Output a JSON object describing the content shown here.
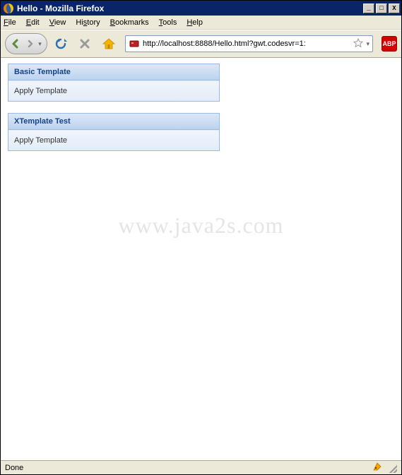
{
  "window": {
    "title": "Hello - Mozilla Firefox"
  },
  "menu": {
    "items": [
      {
        "label": "File",
        "accel": "F"
      },
      {
        "label": "Edit",
        "accel": "E"
      },
      {
        "label": "View",
        "accel": "V"
      },
      {
        "label": "History",
        "accel": "H"
      },
      {
        "label": "Bookmarks",
        "accel": "B"
      },
      {
        "label": "Tools",
        "accel": "T"
      },
      {
        "label": "Help",
        "accel": "H"
      }
    ]
  },
  "toolbar": {
    "url": "http://localhost:8888/Hello.html?gwt.codesvr=1:",
    "abp_label": "ABP"
  },
  "panels": [
    {
      "title": "Basic Template",
      "action": "Apply Template"
    },
    {
      "title": "XTemplate Test",
      "action": "Apply Template"
    }
  ],
  "watermark": "www.java2s.com",
  "status": {
    "text": "Done"
  },
  "win_controls": {
    "minimize": "_",
    "maximize": "□",
    "close": "X"
  }
}
